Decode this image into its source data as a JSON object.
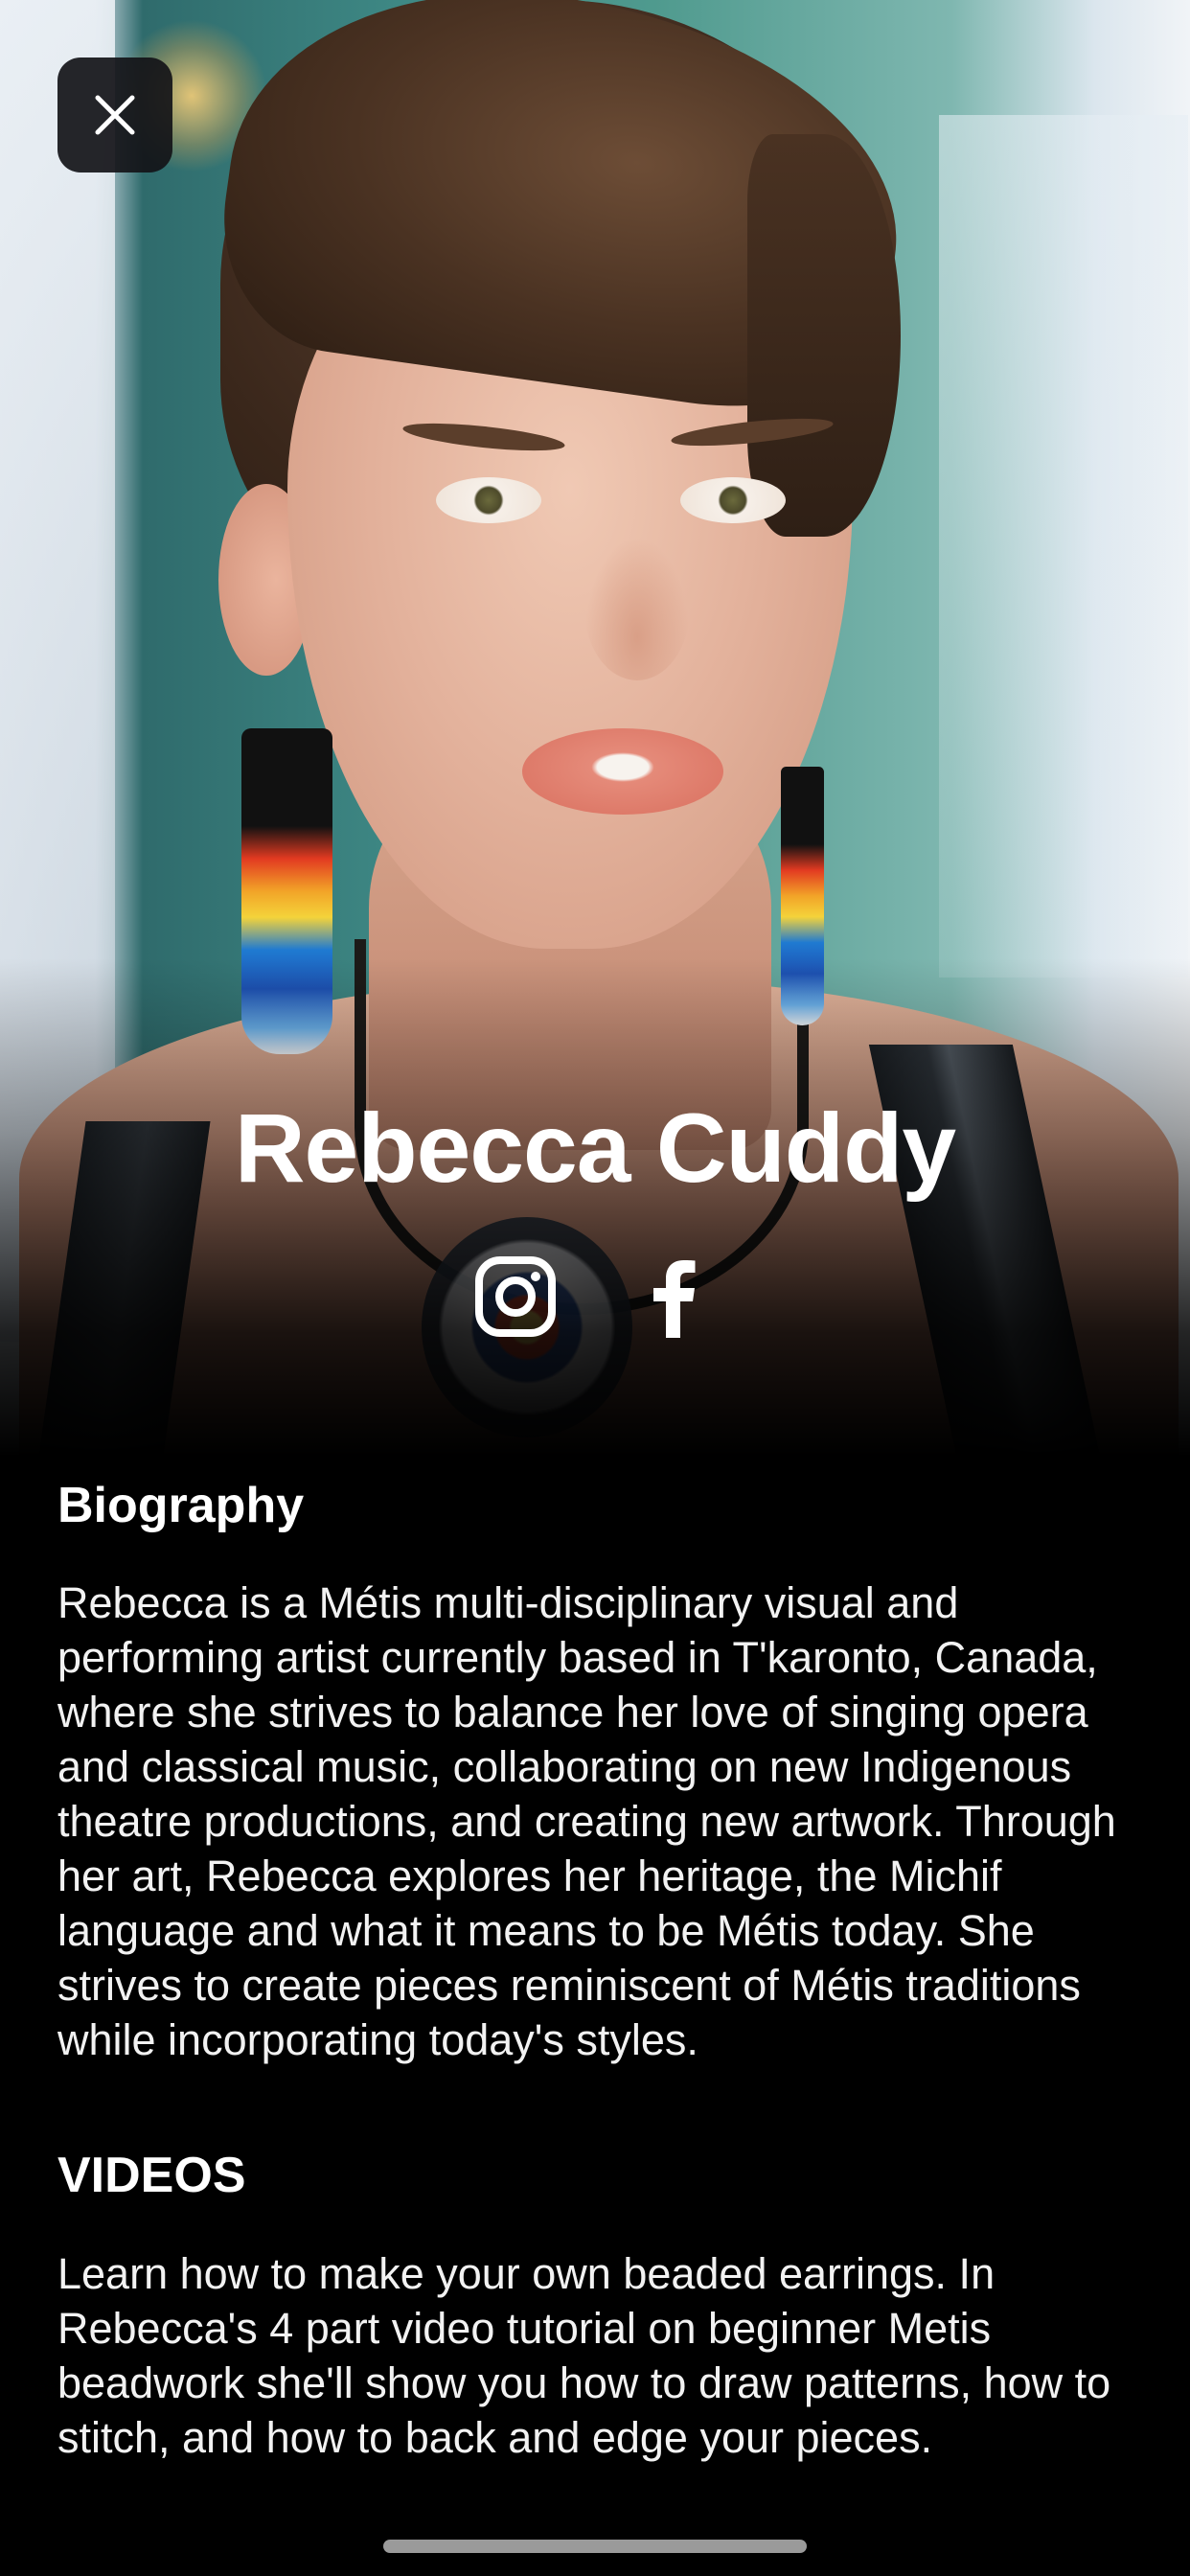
{
  "close_button": {
    "icon": "close-icon"
  },
  "artist": {
    "name": "Rebecca Cuddy"
  },
  "social": {
    "items": [
      {
        "icon": "instagram-icon"
      },
      {
        "icon": "facebook-icon"
      }
    ]
  },
  "biography": {
    "heading": "Biography",
    "body": "Rebecca is a Métis multi-disciplinary visual and performing artist currently based in T'karonto, Canada, where she strives to balance her love of singing opera and classical music, collaborating on new Indigenous theatre productions, and creating new artwork. Through her art, Rebecca explores her heritage, the Michif language and what it means to be Métis today. She strives to create pieces reminiscent of Métis traditions while incorporating today's styles."
  },
  "videos": {
    "heading": "VIDEOS",
    "body": "Learn how to make your own beaded earrings. In Rebecca's 4 part video tutorial on beginner Metis beadwork she'll show you how to draw patterns, how to stitch, and how to back and edge your pieces."
  },
  "colors": {
    "background": "#000000",
    "text": "#ffffff",
    "close_button_bg": "#141418"
  }
}
